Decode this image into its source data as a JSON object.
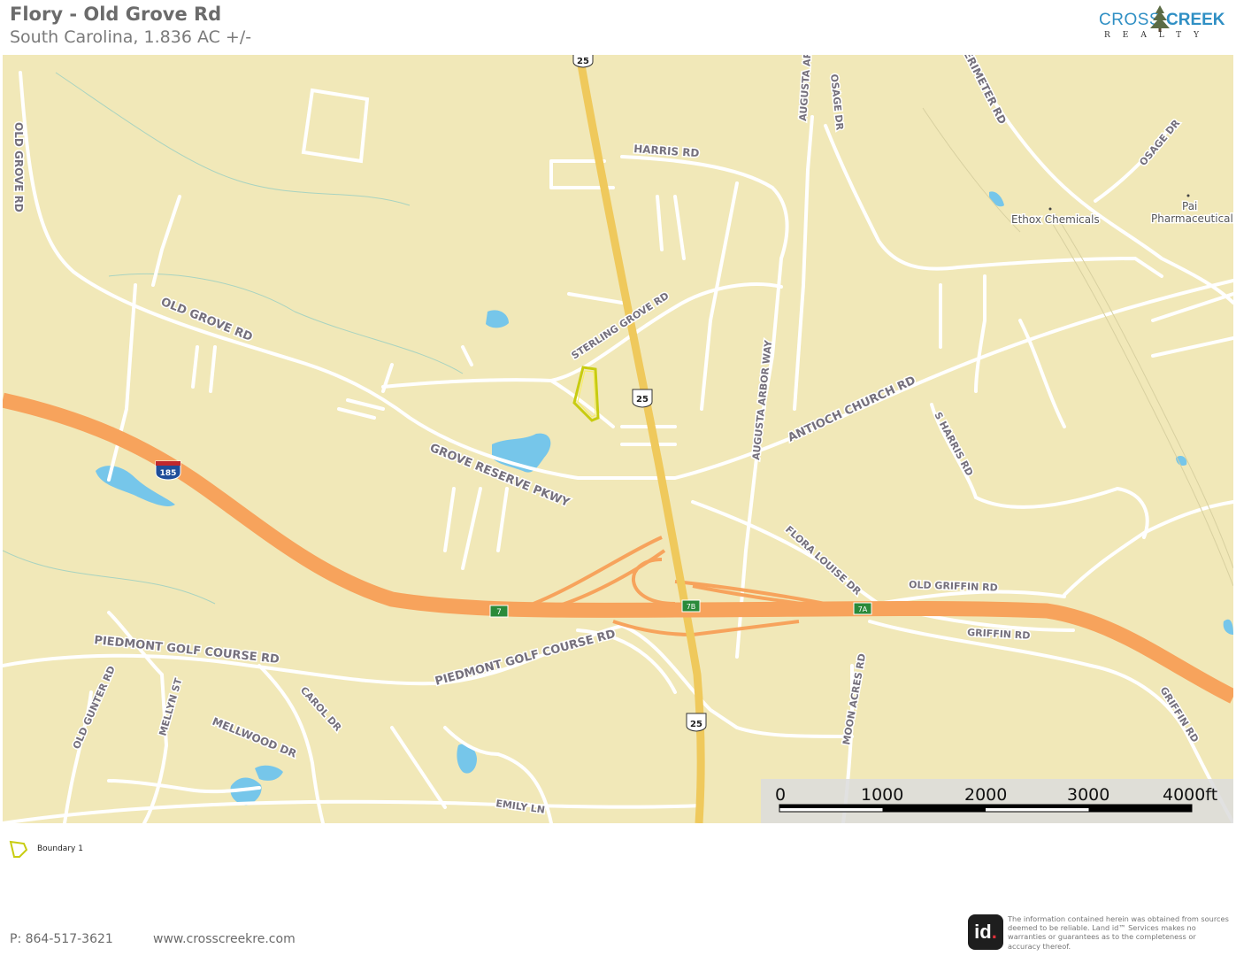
{
  "header": {
    "title": "Flory - Old Grove Rd",
    "subtitle": "South Carolina, 1.836 AC +/-"
  },
  "logo": {
    "brand_part1": "CROSS",
    "brand_part2": "CREEK",
    "tagline": "REALTY",
    "icon": "pine-tree-icon"
  },
  "map": {
    "road_labels": {
      "old_grove_rd_vertical": "OLD GROVE RD",
      "old_grove_rd": "OLD GROVE RD",
      "harris_rd": "HARRIS RD",
      "sterling_grove_rd": "STERLING GROVE RD",
      "grove_reserve_pkwy": "GROVE RESERVE PKWY",
      "antioch_church_rd": "ANTIOCH CHURCH RD",
      "augusta_arbor_way": "AUGUSTA ARBOR WAY",
      "augusta_ar": "AUGUSTA AR",
      "osage_dr_1": "OSAGE DR",
      "osage_dr_2": "OSAGE DR",
      "perimeter_rd": "ERIMETER RD",
      "s_harris_rd": "S HARRIS RD",
      "flora_louise_dr": "FLORA LOUISE DR",
      "old_griffin_rd": "OLD GRIFFIN RD",
      "griffin_rd": "GRIFFIN RD",
      "griffin_rd_2": "GRIFFIN RD",
      "moon_acres_rd": "MOON ACRES RD",
      "piedmont_golf_1": "PIEDMONT GOLF COURSE RD",
      "piedmont_golf_2": "PIEDMONT GOLF COURSE RD",
      "old_gunter_rd": "OLD GUNTER RD",
      "mellyn_st": "MELLYN ST",
      "carol_dr": "CAROL DR",
      "mellwood_dr": "MELLWOOD DR",
      "emily_ln": "EMILY LN"
    },
    "poi_labels": {
      "ethox": "Ethox Chemicals",
      "pai_1": "Pai",
      "pai_2": "Pharmaceutical"
    },
    "shields": {
      "us25_top": "25",
      "us25_mid": "25",
      "us25_bottom": "25",
      "i185": "185",
      "exit7": "7",
      "exit7b": "7B",
      "exit7a": "7A"
    },
    "colors": {
      "land": "#f1e8b8",
      "interstate": "#f7a35c",
      "highway": "#efc95c",
      "water": "#76c6ea",
      "boundary": "#c8cc10",
      "exit_sign": "#2a8a3a"
    }
  },
  "scale_bar": {
    "labels": [
      "0",
      "1000",
      "2000",
      "3000",
      "4000ft"
    ]
  },
  "legend": {
    "label": "Boundary 1",
    "icon": "boundary-polygon-icon"
  },
  "footer": {
    "phone": "P: 864-517-3621",
    "website": "www.crosscreekre.com",
    "id_logo_letters": "id",
    "id_logo_dot": ".",
    "disclaimer": "The information contained herein was obtained from sources deemed to be reliable. Land id™ Services makes no warranties or guarantees as to the completeness or accuracy thereof."
  }
}
